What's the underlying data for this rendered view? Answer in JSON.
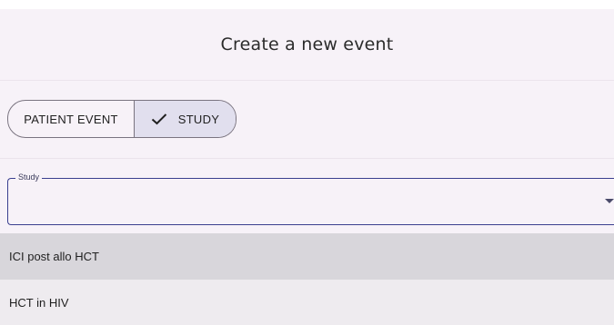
{
  "dialog": {
    "title": "Create a new event"
  },
  "event_type_toggle": {
    "options": [
      {
        "label": "PATIENT EVENT",
        "selected": false
      },
      {
        "label": "STUDY",
        "selected": true
      }
    ],
    "selected_icon": "check-icon"
  },
  "study_field": {
    "label": "Study",
    "value": ""
  },
  "study_options": [
    {
      "label": "ICI post allo HCT",
      "highlighted": true
    },
    {
      "label": "HCT in HIV",
      "highlighted": false
    }
  ],
  "colors": {
    "background": "#f7f2f8",
    "accent_border": "#3a3f8f",
    "selected_segment": "#e1dfee",
    "highlighted_option": "#d8d6db"
  }
}
